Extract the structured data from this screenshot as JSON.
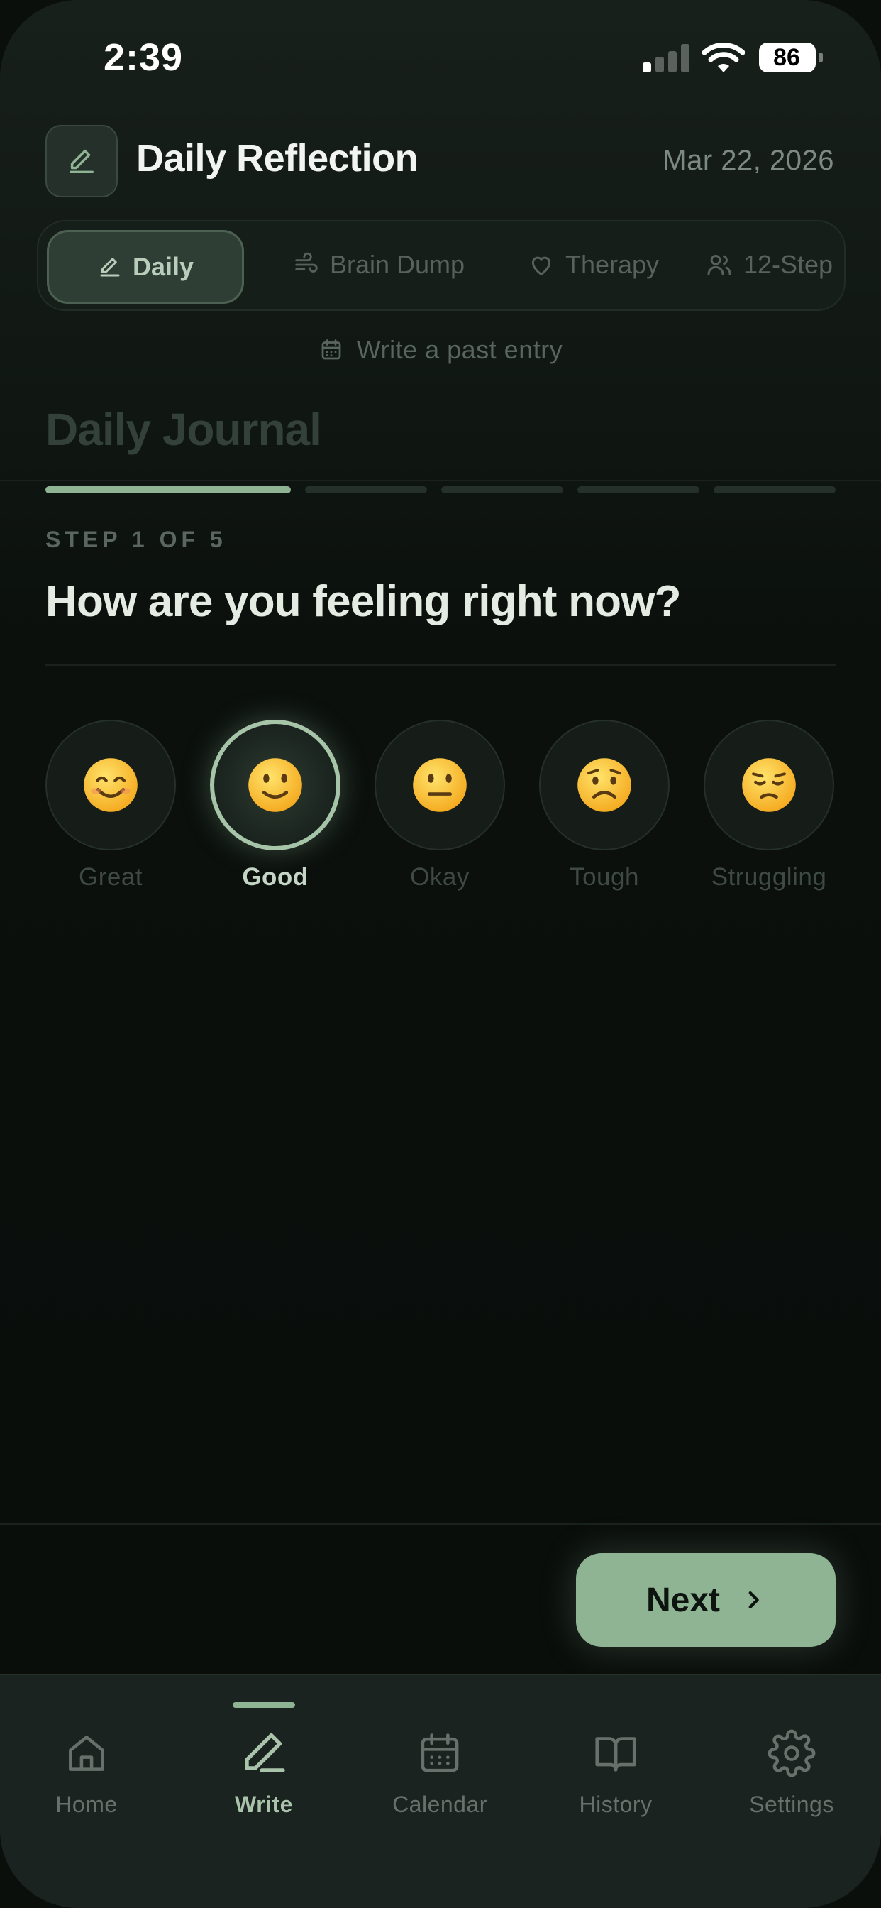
{
  "status": {
    "time": "2:39",
    "battery": "86"
  },
  "header": {
    "title": "Daily Reflection",
    "date": "Mar 22, 2026"
  },
  "modes": [
    {
      "label": "Daily",
      "icon": "pencil-icon",
      "active": true
    },
    {
      "label": "Brain Dump",
      "icon": "wind-icon",
      "active": false
    },
    {
      "label": "Therapy",
      "icon": "heart-icon",
      "active": false
    },
    {
      "label": "12-Step",
      "icon": "users-icon",
      "active": false
    }
  ],
  "past_entry_label": "Write a past entry",
  "journal_title": "Daily Journal",
  "progress": {
    "current_step": 1,
    "total_steps": 5
  },
  "step_label": "STEP 1 OF 5",
  "question": "How are you feeling right now?",
  "moods": [
    {
      "emoji": "😊",
      "label": "Great",
      "selected": false
    },
    {
      "emoji": "🙂",
      "label": "Good",
      "selected": true
    },
    {
      "emoji": "😐",
      "label": "Okay",
      "selected": false
    },
    {
      "emoji": "😟",
      "label": "Tough",
      "selected": false
    },
    {
      "emoji": "😔",
      "label": "Struggling",
      "selected": false
    }
  ],
  "next_label": "Next",
  "tabbar": [
    {
      "label": "Home",
      "icon": "home-icon",
      "active": false
    },
    {
      "label": "Write",
      "icon": "pencil-icon",
      "active": true
    },
    {
      "label": "Calendar",
      "icon": "calendar-icon",
      "active": false
    },
    {
      "label": "History",
      "icon": "book-icon",
      "active": false
    },
    {
      "label": "Settings",
      "icon": "gear-icon",
      "active": false
    }
  ],
  "colors": {
    "accent": "#8fb493",
    "background": "#0a0f0c"
  }
}
